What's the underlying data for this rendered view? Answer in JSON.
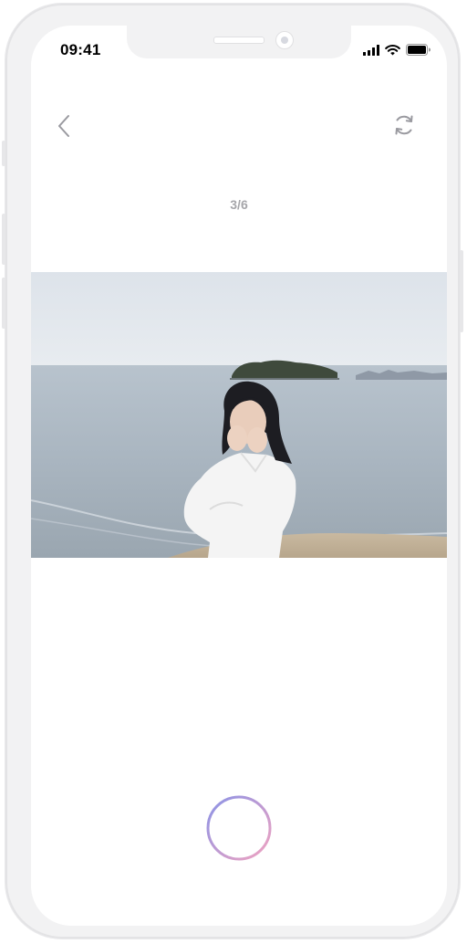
{
  "status_bar": {
    "time": "09:41"
  },
  "nav": {
    "back_icon": "chevron-left-icon",
    "rotate_icon": "refresh-icon"
  },
  "counter": "3/6",
  "photo": {
    "subject": "photo-viewer-image"
  },
  "colors": {
    "shutter_start": "#8b93e6",
    "shutter_end": "#f1a3c0",
    "counter": "#a6a6aa",
    "frame": "#f2f2f3"
  }
}
